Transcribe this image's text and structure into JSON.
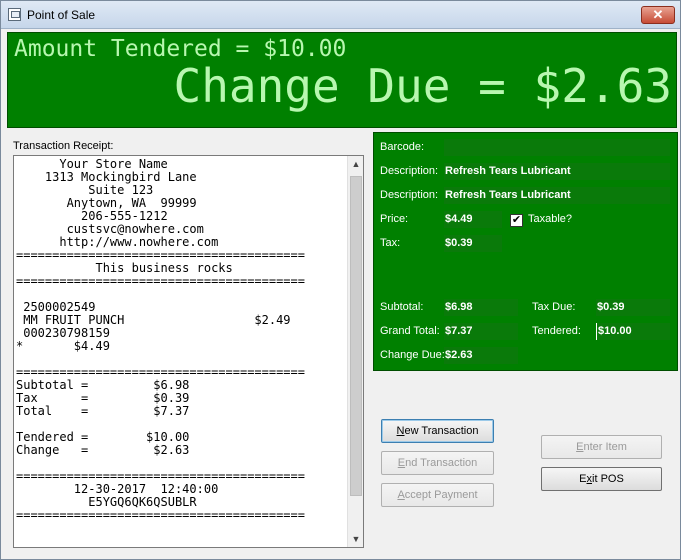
{
  "window": {
    "title": "Point of Sale",
    "close_glyph": "✕"
  },
  "display": {
    "amount_tendered": "Amount Tendered = $10.00",
    "change_due": "Change Due = $2.63"
  },
  "receipt": {
    "label": "Transaction Receipt:",
    "lines": [
      "      Your Store Name",
      "    1313 Mockingbird Lane",
      "          Suite 123",
      "       Anytown, WA  99999",
      "         206-555-1212",
      "       custsvc@nowhere.com",
      "      http://www.nowhere.com",
      "========================================",
      "           This business rocks",
      "========================================",
      "",
      " 2500002549",
      " MM FRUIT PUNCH                  $2.49",
      " 000230798159",
      "*       $4.49",
      "",
      "========================================",
      "Subtotal =         $6.98",
      "Tax      =         $0.39",
      "Total    =         $7.37",
      "",
      "Tendered =        $10.00",
      "Change   =         $2.63",
      "",
      "========================================",
      "        12-30-2017  12:40:00",
      "          E5YGQ6QK6QSUBLR",
      "========================================"
    ]
  },
  "item": {
    "barcode_label": "Barcode:",
    "barcode_value": "",
    "description_label_1": "Description:",
    "description_value_1": "Refresh Tears Lubricant",
    "description_label_2": "Description:",
    "description_value_2": "Refresh Tears Lubricant",
    "price_label": "Price:",
    "price_value": "$4.49",
    "taxable_label": "Taxable?",
    "taxable_checked": true,
    "tax_label": "Tax:",
    "tax_value": "$0.39"
  },
  "totals": {
    "subtotal_label": "Subtotal:",
    "subtotal_value": "$6.98",
    "tax_due_label": "Tax Due:",
    "tax_due_value": "$0.39",
    "grand_total_label": "Grand Total:",
    "grand_total_value": "$7.37",
    "tendered_label": "Tendered:",
    "tendered_value": "$10.00",
    "change_due_label": "Change Due:",
    "change_due_value": "$2.63"
  },
  "buttons": {
    "new_transaction": {
      "mnemonic": "N",
      "rest": "ew Transaction",
      "enabled": true
    },
    "end_transaction": {
      "mnemonic": "E",
      "rest": "nd Transaction",
      "enabled": false
    },
    "accept_payment": {
      "mnemonic": "A",
      "rest": "ccept Payment",
      "enabled": false
    },
    "enter_item": {
      "mnemonic": "E",
      "rest": "nter Item",
      "enabled": false
    },
    "exit_pos": {
      "mnemonic": "x",
      "pre": "E",
      "rest": "it POS",
      "enabled": true
    }
  },
  "colors": {
    "panel_green": "#008000",
    "display_text": "#b8f7b0"
  }
}
